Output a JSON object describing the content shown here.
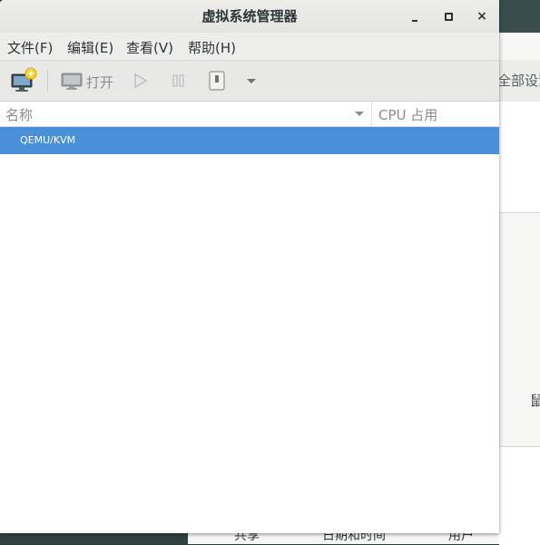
{
  "window": {
    "title": "虚拟系统管理器",
    "close_glyph": "×"
  },
  "menu": {
    "file": "文件(F)",
    "edit": "编辑(E)",
    "view": "查看(V)",
    "help": "帮助(H)"
  },
  "toolbar": {
    "open_label": "打开"
  },
  "list": {
    "columns": {
      "name": "名称",
      "cpu": "CPU 占用"
    },
    "rows": [
      {
        "name": "QEMU/KVM",
        "selected": true
      }
    ]
  },
  "background_window": {
    "tab_label": "全部设置",
    "side_glyph": "鼠",
    "bottom_labels": [
      "共享",
      "日期和时间",
      "用户"
    ]
  },
  "colors": {
    "selection": "#4a90d9",
    "titlebar": "#e8e8e6",
    "desktop": "#2b3c3c"
  }
}
